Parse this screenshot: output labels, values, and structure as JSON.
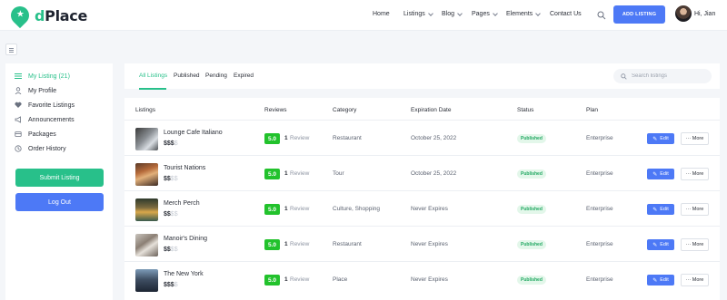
{
  "brand": {
    "logo_text_accent": "d",
    "logo_text_rest": "Place",
    "accent_color": "#28c08a",
    "primary_color": "#4d79f6"
  },
  "nav": {
    "items": [
      {
        "label": "Home",
        "dropdown": false
      },
      {
        "label": "Listings",
        "dropdown": true
      },
      {
        "label": "Blog",
        "dropdown": true
      },
      {
        "label": "Pages",
        "dropdown": true
      },
      {
        "label": "Elements",
        "dropdown": true
      },
      {
        "label": "Contact Us",
        "dropdown": false
      }
    ],
    "add_listing_label": "ADD LISTING",
    "greeting": "Hi, Jian"
  },
  "sidebar": {
    "items": [
      {
        "label": "My Listing (21)",
        "icon": "list-icon",
        "active": true
      },
      {
        "label": "My Profile",
        "icon": "user-icon",
        "active": false
      },
      {
        "label": "Favorite Listings",
        "icon": "heart-icon",
        "active": false
      },
      {
        "label": "Announcements",
        "icon": "megaphone-icon",
        "active": false
      },
      {
        "label": "Packages",
        "icon": "package-icon",
        "active": false
      },
      {
        "label": "Order History",
        "icon": "clock-icon",
        "active": false
      }
    ],
    "submit_label": "Submit Listing",
    "logout_label": "Log Out"
  },
  "tabs": {
    "items": [
      "All Listings",
      "Published",
      "Pending",
      "Expired"
    ],
    "search_placeholder": "Search listings"
  },
  "table": {
    "headers": [
      "Listings",
      "Reviews",
      "Category",
      "Expiration Date",
      "Status",
      "Plan"
    ],
    "rows": [
      {
        "name": "Lounge Cafe Italiano",
        "price_on": "$$$",
        "price_off": "$",
        "score": "5.0",
        "review_count": "1",
        "review_word": "Review",
        "category": "Restaurant",
        "expiration": "October 25, 2022",
        "status": "Published",
        "plan": "Enterprise",
        "edit": "Edit",
        "more": "··· More"
      },
      {
        "name": "Tourist Nations",
        "price_on": "$$",
        "price_off": "$$",
        "score": "5.0",
        "review_count": "1",
        "review_word": "Review",
        "category": "Tour",
        "expiration": "October 25, 2022",
        "status": "Published",
        "plan": "Enterprise",
        "edit": "Edit",
        "more": "··· More"
      },
      {
        "name": "Merch Perch",
        "price_on": "$$",
        "price_off": "$$",
        "score": "5.0",
        "review_count": "1",
        "review_word": "Review",
        "category": "Culture, Shopping",
        "expiration": "Never Expires",
        "status": "Published",
        "plan": "Enterprise",
        "edit": "Edit",
        "more": "··· More"
      },
      {
        "name": "Manoir's Dining",
        "price_on": "$$",
        "price_off": "$$",
        "score": "5.0",
        "review_count": "1",
        "review_word": "Review",
        "category": "Restaurant",
        "expiration": "Never Expires",
        "status": "Published",
        "plan": "Enterprise",
        "edit": "Edit",
        "more": "··· More"
      },
      {
        "name": "The New York",
        "price_on": "$$$",
        "price_off": "$",
        "score": "5.0",
        "review_count": "1",
        "review_word": "Review",
        "category": "Place",
        "expiration": "Never Expires",
        "status": "Published",
        "plan": "Enterprise",
        "edit": "Edit",
        "more": "··· More"
      }
    ]
  }
}
